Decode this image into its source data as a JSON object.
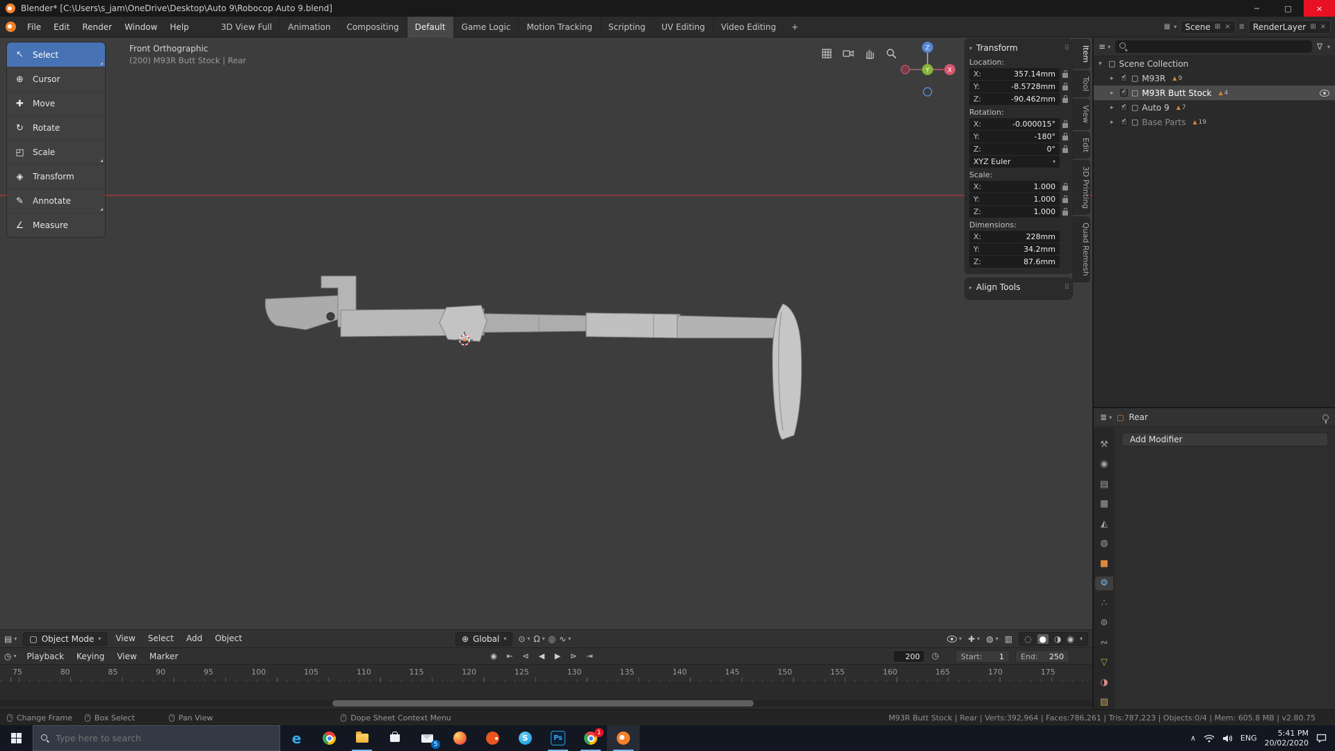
{
  "icons": {
    "minimize": "─",
    "maximize": "□",
    "close": "×",
    "caret_down": "▾",
    "caret_right": "▸",
    "drag_dots": "⠿",
    "filter": "∇",
    "new": "⊞",
    "unlink": "×",
    "scene_editor": "▦",
    "viewlayer_editor": "≣",
    "outliner_editor": "≡",
    "properties_editor": "≣",
    "viewport_editor": "▤",
    "timeline_editor": "◷",
    "object_mode": "▢",
    "orientation_globe": "⊕",
    "pivot": "⊙",
    "magnet": "Ω",
    "proportional": "◎",
    "falloff": "∿",
    "gizmo_toggle": "✚",
    "overlays_toggle": "◍",
    "xray_toggle": "▥",
    "shading_wireframe": "◌",
    "shading_solid": "●",
    "shading_material": "◑",
    "shading_rendered": "◉",
    "hidden_tray": "∧",
    "breadcrumb_object": "▢",
    "collection": "▢",
    "mesh_badge": "▲",
    "clock": "◷"
  },
  "window": {
    "title": "Blender* [C:\\Users\\s_jam\\OneDrive\\Desktop\\Auto 9\\Robocop Auto 9.blend]"
  },
  "topbar": {
    "menus": [
      "File",
      "Edit",
      "Render",
      "Window",
      "Help"
    ],
    "workspaces": [
      "3D View Full",
      "Animation",
      "Compositing",
      "Default",
      "Game Logic",
      "Motion Tracking",
      "Scripting",
      "UV Editing",
      "Video Editing"
    ],
    "add_workspace": "+",
    "scene_label": "Scene",
    "view_layer_label": "RenderLayer"
  },
  "toolbar": {
    "tools": [
      {
        "label": "Select",
        "glyph": "↖"
      },
      {
        "label": "Cursor",
        "glyph": "⊕"
      },
      {
        "label": "Move",
        "glyph": "✚"
      },
      {
        "label": "Rotate",
        "glyph": "↻"
      },
      {
        "label": "Scale",
        "glyph": "◰"
      },
      {
        "label": "Transform",
        "glyph": "◈"
      },
      {
        "label": "Annotate",
        "glyph": "✎"
      },
      {
        "label": "Measure",
        "glyph": "∠"
      }
    ]
  },
  "viewport": {
    "view_label": "Front Orthographic",
    "context_label": "(200) M93R Butt Stock | Rear",
    "gizmo": {
      "x": "X",
      "y": "Y",
      "z": "Z"
    }
  },
  "sidebar": {
    "tabs": [
      "Item",
      "Tool",
      "View",
      "Edit",
      "3D Printing",
      "Quad Remesh"
    ],
    "axes": {
      "x": "X:",
      "y": "Y:",
      "z": "Z:"
    },
    "transform": {
      "title": "Transform",
      "location": {
        "label": "Location:",
        "x": "357.14mm",
        "y": "-8.5728mm",
        "z": "-90.462mm"
      },
      "rotation": {
        "label": "Rotation:",
        "x": "-0.000015°",
        "y": "-180°",
        "z": "0°",
        "mode": "XYZ Euler"
      },
      "scale": {
        "label": "Scale:",
        "x": "1.000",
        "y": "1.000",
        "z": "1.000"
      },
      "dimensions": {
        "label": "Dimensions:",
        "x": "228mm",
        "y": "34.2mm",
        "z": "87.6mm"
      }
    },
    "align_tools_label": "Align Tools"
  },
  "outliner": {
    "rows": [
      {
        "arrow": "▾",
        "label": "Scene Collection",
        "badge": ""
      },
      {
        "arrow": "▸",
        "label": "M93R",
        "badge": "9"
      },
      {
        "arrow": "▸",
        "label": "M93R Butt Stock",
        "badge": "4"
      },
      {
        "arrow": "▸",
        "label": "Auto 9",
        "badge": "7"
      },
      {
        "arrow": "▸",
        "label": "Base Parts",
        "badge": "19"
      }
    ]
  },
  "properties": {
    "breadcrumb": "Rear",
    "add_modifier_label": "Add Modifier",
    "tabs": [
      {
        "name": "tool",
        "glyph": "⚒"
      },
      {
        "name": "render",
        "glyph": "◉"
      },
      {
        "name": "output",
        "glyph": "▤"
      },
      {
        "name": "view-layer",
        "glyph": "▦"
      },
      {
        "name": "scene",
        "glyph": "◭"
      },
      {
        "name": "world",
        "glyph": "◍"
      },
      {
        "name": "object",
        "glyph": "■"
      },
      {
        "name": "modifiers",
        "glyph": "⚙"
      },
      {
        "name": "particles",
        "glyph": "∴"
      },
      {
        "name": "physics",
        "glyph": "⊚"
      },
      {
        "name": "constraints",
        "glyph": "∾"
      },
      {
        "name": "object-data",
        "glyph": "▽"
      },
      {
        "name": "material",
        "glyph": "◑"
      },
      {
        "name": "texture",
        "glyph": "▨"
      }
    ]
  },
  "vp_header": {
    "mode": "Object Mode",
    "menus": [
      "View",
      "Select",
      "Add",
      "Object"
    ],
    "orientation": "Global"
  },
  "timeline": {
    "menus": [
      "Playback",
      "Keying",
      "View",
      "Marker"
    ],
    "transport": [
      {
        "name": "auto-key",
        "glyph": "◉"
      },
      {
        "name": "jump-start",
        "glyph": "⇤"
      },
      {
        "name": "prev-keyframe",
        "glyph": "⊲"
      },
      {
        "name": "play-reverse",
        "glyph": "◀"
      },
      {
        "name": "play",
        "glyph": "▶"
      },
      {
        "name": "next-keyframe",
        "glyph": "⊳"
      },
      {
        "name": "jump-end",
        "glyph": "⇥"
      }
    ],
    "current_frame": "200",
    "start_label": "Start:",
    "start_value": "1",
    "end_label": "End:",
    "end_value": "250",
    "ruler": [
      75,
      80,
      85,
      90,
      95,
      100,
      105,
      110,
      115,
      120,
      125,
      130,
      135,
      140,
      145,
      150,
      155,
      160,
      165,
      170,
      175
    ]
  },
  "statusbar": {
    "hints": [
      "Change Frame",
      "Box Select",
      "Pan View",
      "Dope Sheet Context Menu"
    ],
    "info": "M93R Butt Stock | Rear | Verts:392,964 | Faces:786,261 | Tris:787,223 | Objects:0/4 | Mem: 605.8 MB | v2.80.75"
  },
  "taskbar": {
    "search_placeholder": "Type here to search",
    "apps": [
      {
        "name": "edge",
        "glyph": "e"
      },
      {
        "name": "chrome"
      },
      {
        "name": "file-explorer"
      },
      {
        "name": "store"
      },
      {
        "name": "mail",
        "badge": "5"
      },
      {
        "name": "photos"
      },
      {
        "name": "ubuntu"
      },
      {
        "name": "skype",
        "glyph": "S"
      },
      {
        "name": "photoshop",
        "glyph": "Ps"
      },
      {
        "name": "chrome-2",
        "badge": "1"
      },
      {
        "name": "blender"
      }
    ],
    "tray": {
      "language": "ENG",
      "time": "5:41 PM",
      "date": "20/02/2020"
    }
  }
}
